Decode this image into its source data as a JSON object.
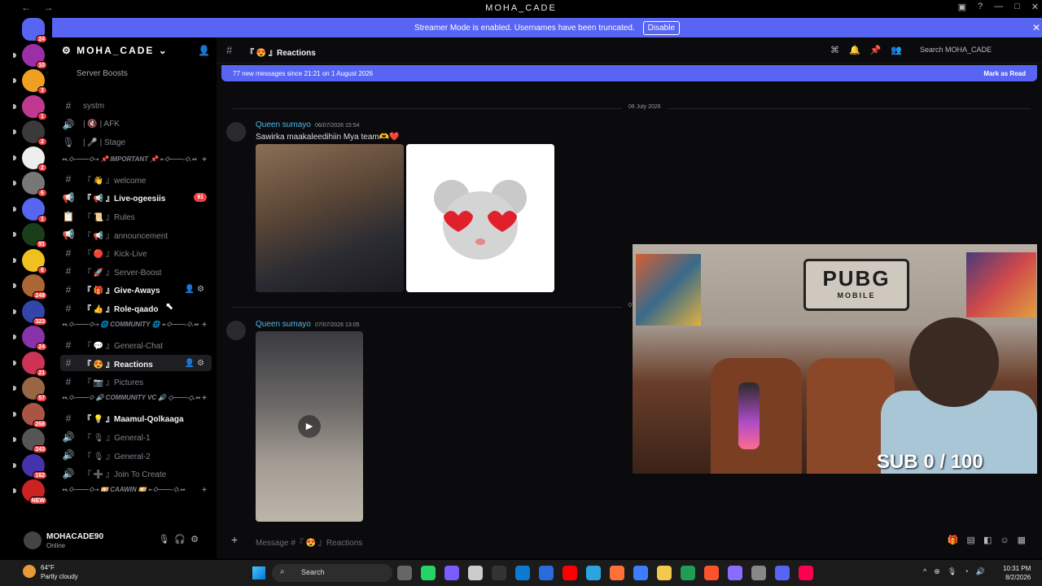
{
  "window": {
    "title": "MOHA_CADE"
  },
  "banner": {
    "text": "Streamer Mode is enabled. Usernames have been truncated.",
    "button": "Disable"
  },
  "guilds": [
    {
      "badge": "24",
      "color": "#5865f2"
    },
    {
      "badge": "10",
      "color": "#9b2fa8"
    },
    {
      "badge": "3",
      "color": "#f0a020"
    },
    {
      "badge": "1",
      "color": "#c0398e"
    },
    {
      "badge": "2",
      "color": "#3a3a3a"
    },
    {
      "badge": "2",
      "color": "#eeeeee"
    },
    {
      "badge": "6",
      "color": "#777777"
    },
    {
      "badge": "1",
      "color": "#5865f2"
    },
    {
      "badge": "91",
      "color": "#1a3d1a"
    },
    {
      "badge": "6",
      "color": "#f0c020"
    },
    {
      "badge": "249",
      "color": "#aa6633"
    },
    {
      "badge": "323",
      "color": "#3344aa"
    },
    {
      "badge": "24",
      "color": "#8833aa"
    },
    {
      "badge": "21",
      "color": "#cc3355"
    },
    {
      "badge": "57",
      "color": "#996644"
    },
    {
      "badge": "268",
      "color": "#aa5544"
    },
    {
      "badge": "243",
      "color": "#555555"
    },
    {
      "badge": "162",
      "color": "#4433aa"
    },
    {
      "badge": "NEW",
      "color": "#cc2222"
    }
  ],
  "sidebar": {
    "server_name": "MOHA_CADE",
    "boosts_label": "Server Boosts",
    "channels": [
      {
        "icon": "#",
        "label": "systm",
        "bold": false
      },
      {
        "icon": "🔊",
        "label": "| 🔇 | AFK",
        "bold": false
      },
      {
        "icon": "🎙",
        "label": "| 🎤 | Stage",
        "bold": false
      },
      {
        "cat": "⬩⬩.◇-——◇-⬩ 📌 IMPORTANT 📌 ⬩-◇——-◇.⬩⬩"
      },
      {
        "icon": "#",
        "label": "『 👋 』welcome",
        "bold": false
      },
      {
        "icon": "📢",
        "label": "『 📢 』Live-ogeesiis",
        "bold": true,
        "mention": "91"
      },
      {
        "icon": "📋",
        "label": "『 📜 』Rules",
        "bold": false
      },
      {
        "icon": "📢",
        "label": "『 📢 』announcement",
        "bold": false
      },
      {
        "icon": "#",
        "label": "『 🔴 』Kick-Live",
        "bold": false
      },
      {
        "icon": "#",
        "label": "『 🚀 』Server-Boost",
        "bold": false
      },
      {
        "icon": "#",
        "label": "『 🎁 』Give-Aways",
        "bold": true,
        "tools": true
      },
      {
        "icon": "#",
        "label": "『 👍 』Role-qaado",
        "bold": true
      },
      {
        "cat": "⬩⬩.◇-——◇-⬩ 🌐 COMMUNITY 🌐 ⬩-◇——-◇.⬩⬩"
      },
      {
        "icon": "#",
        "label": "『 💬 』General-Chat",
        "bold": false
      },
      {
        "icon": "#",
        "label": "『 😍 』Reactions",
        "bold": true,
        "selected": true,
        "tools": true
      },
      {
        "icon": "#",
        "label": "『 📷 』Pictures",
        "bold": false
      },
      {
        "cat": "⬩⬩.◇-——◇ 🔊 COMMUNITY VC 🔊 ◇——-◇.⬩⬩"
      },
      {
        "icon": "#",
        "label": "『 💡 』Maamul-Qolkaaga",
        "bold": true
      },
      {
        "icon": "🔊",
        "label": "『 🎙 』General-1",
        "bold": false
      },
      {
        "icon": "🔊",
        "label": "『 🎙 』General-2",
        "bold": false
      },
      {
        "icon": "🔊",
        "label": "『 ➕ 』Join To Create",
        "bold": false
      },
      {
        "cat": "⬩⬩.◇-——◇-⬩ 💴 CAAWIN 💴 ⬩-◇——-◇.⬩⬩"
      }
    ]
  },
  "user": {
    "name": "MOHACADE90",
    "status": "Online"
  },
  "chat": {
    "channel_name": "『 😍 』Reactions",
    "search_placeholder": "Search MOHA_CADE",
    "new_messages": "77 new messages since 21:21 on 1 August 2026",
    "mark_read": "Mark as Read",
    "date_divider_1": "06 July 2026",
    "date_divider_2": "07 July 2026",
    "messages": [
      {
        "author": "Queen sumayo",
        "time": "06/07/2026 15:54",
        "text": "Sawirka maakaleedihiin Mya team🫶❤️"
      },
      {
        "author": "Queen sumayo",
        "time": "07/07/2026 13:05",
        "text": ""
      }
    ],
    "composer_placeholder": "Message #『 😍 』Reactions"
  },
  "stream_overlay": {
    "sign_top": "PUBG",
    "sign_bottom": "MOBILE",
    "sub_counter": "SUB 0 / 100"
  },
  "taskbar": {
    "temperature": "64°F",
    "weather": "Partly cloudy",
    "search": "Search",
    "time": "10:31 PM",
    "date": "8/2/2026",
    "app_colors": [
      "#666666",
      "#25d366",
      "#7b5cff",
      "#cccccc",
      "#333333",
      "#0a7bd1",
      "#2a6adb",
      "#ff0000",
      "#2aa5e0",
      "#ff7139",
      "#3d7eff",
      "#f2c94c",
      "#1f9d55",
      "#fb542b",
      "#8a6cff",
      "#888888",
      "#5865f2",
      "#ff0050"
    ]
  }
}
